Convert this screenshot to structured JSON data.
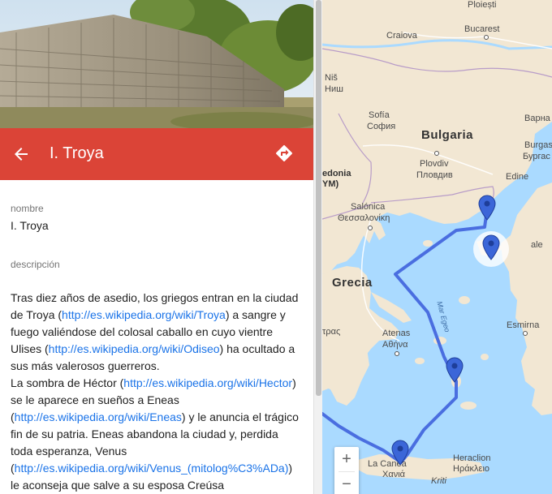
{
  "place": {
    "title": "I. Troya"
  },
  "fields": {
    "name_label": "nombre",
    "name_value": "I. Troya",
    "description_label": "descripción"
  },
  "description": {
    "p1_a": "Tras diez años de asedio, los griegos entran en la ciudad de Troya (",
    "p1_link1": "http://es.wikipedia.org/wiki/Troya",
    "p1_b": ") a sangre y fuego valiéndose del colosal caballo en cuyo vientre Ulises (",
    "p1_link2": "http://es.wikipedia.org/wiki/Odiseo",
    "p1_c": ") ha ocultado a sus más valerosos guerreros.",
    "p2_a": "La sombra de Héctor (",
    "p2_link1": "http://es.wikipedia.org/wiki/Hector",
    "p2_b": ") se le aparece en sueños a Eneas (",
    "p2_link2": "http://es.wikipedia.org/wiki/Eneas",
    "p2_c": ") y le anuncia el trágico fin de su patria. Eneas abandona la ciudad y, perdida toda esperanza, Venus (",
    "p2_link3": "http://es.wikipedia.org/wiki/Venus_(mitolog%C3%ADa)",
    "p2_d": ") le aconseja que salve a su esposa Creúsa"
  },
  "map": {
    "labels": {
      "ploiesti": "Ploiești",
      "craiova": "Craiova",
      "bucarest": "Bucarest",
      "nis": "Niš",
      "nis_cyr": "Ниш",
      "sofia": "Sofía",
      "sofia_cyr": "София",
      "bulgaria": "Bulgaria",
      "varna_cyr": "Варна",
      "burgas": "Burgas",
      "burgas_cyr": "Бургас",
      "plovdiv": "Plovdiv",
      "plovdiv_cyr": "Пловдив",
      "edine": "Edine",
      "macedonia1": "edonia",
      "macedonia2": "YM)",
      "salonica": "Salónica",
      "salonica_gr": "Θεσσαλονίκη",
      "grecia": "Grecia",
      "mar_egeo": "Mar Egeo",
      "atenas": "Atenas",
      "atenas_gr": "Αθήνα",
      "esmirna": "Esmirna",
      "patras_gr": "τρας",
      "heraclion": "Heraclion",
      "heraclion_gr": "Ηράκλειο",
      "la_canea": "La Canea",
      "la_canea_gr": "Χανιά",
      "kriti": "Kriti",
      "bale": "ale"
    },
    "colors": {
      "route": "#4a6ee0",
      "pin": "#3b66d8",
      "sea": "#aadaff",
      "land": "#f2e7d3"
    },
    "zoom_in": "+",
    "zoom_out": "−"
  },
  "icons": {
    "back": "arrow-left-icon",
    "directions": "directions-icon"
  }
}
